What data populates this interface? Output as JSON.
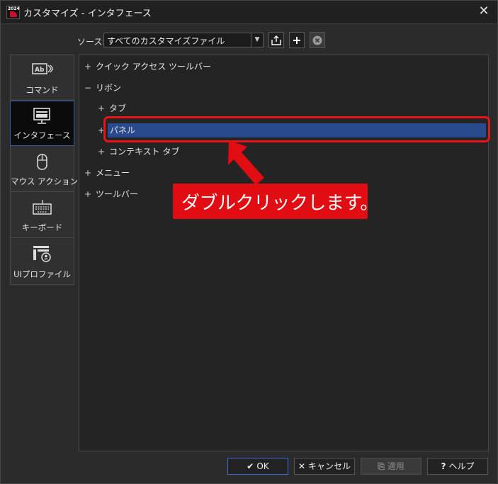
{
  "window": {
    "title": "カスタマイズ - インタフェース",
    "app_icon_year": "2024"
  },
  "source": {
    "label": "ソース:",
    "value": "すべてのカスタマイズファイル"
  },
  "nav": {
    "items": [
      {
        "label": "コマンド",
        "icon": "command-ab-icon",
        "active": false
      },
      {
        "label": "インタフェース",
        "icon": "monitor-icon",
        "active": true
      },
      {
        "label": "マウス アクション",
        "icon": "mouse-icon",
        "active": false
      },
      {
        "label": "キーボード",
        "icon": "keyboard-icon",
        "active": false
      },
      {
        "label": "UIプロファイル",
        "icon": "ui-profile-icon",
        "active": false
      }
    ]
  },
  "tree": {
    "quick_access": {
      "expander": "+",
      "label": "クイック アクセス ツールバー"
    },
    "ribbon": {
      "expander": "−",
      "label": "リボン"
    },
    "tab": {
      "expander": "+",
      "label": "タブ"
    },
    "panel": {
      "expander": "+",
      "label": "パネル"
    },
    "context_tab": {
      "expander": "+",
      "label": "コンテキスト タブ"
    },
    "menu": {
      "expander": "+",
      "label": "メニュー"
    },
    "toolbar": {
      "expander": "+",
      "label": "ツールバー"
    }
  },
  "annotation": {
    "callout_text": "ダブルクリックします。",
    "highlight_color": "#e8141c"
  },
  "buttons": {
    "ok": "OK",
    "cancel": "キャンセル",
    "apply": "適用",
    "help": "ヘルプ"
  },
  "colors": {
    "selection": "#2a4a8e",
    "accent_border": "#3a6bd0",
    "callout_bg": "#e10d12"
  }
}
